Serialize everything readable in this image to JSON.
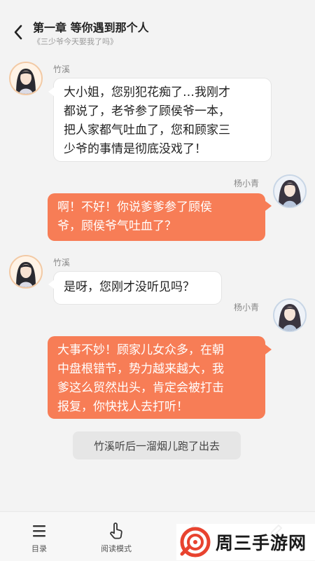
{
  "header": {
    "title": "第一章 等你遇到那个人",
    "subtitle": "《三少爷今天娶我了吗》"
  },
  "messages": [
    {
      "speaker": "竹溪",
      "side": "left",
      "text": [
        "大小姐，您别犯花痴了…我刚才",
        "都说了，老爷参了顾侯爷一本，",
        "把人家都气吐血了，您和顾家三",
        "少爷的事情是彻底没戏了！"
      ]
    },
    {
      "speaker": "杨小青",
      "side": "right",
      "text": [
        "啊！不好！你说爹爹参了顾侯",
        "爷，顾侯爷气吐血了？"
      ]
    },
    {
      "speaker": "竹溪",
      "side": "left",
      "text": [
        "是呀，您刚才没听见吗？"
      ]
    },
    {
      "speaker": "杨小青",
      "side": "right",
      "text": [
        "大事不妙！顾家儿女众多，在朝",
        "中盘根错节，势力越来越大，我",
        "爹这么贸然出头，肯定会被打击",
        "报复，你快找人去打听！"
      ]
    }
  ],
  "narration": "竹溪听后一溜烟儿跑了出去",
  "bottom_nav": [
    {
      "label": "目录",
      "icon": "menu-icon"
    },
    {
      "label": "阅读模式",
      "icon": "tap-hand-icon"
    },
    {
      "label": "",
      "icon": "undo-icon"
    },
    {
      "label": "",
      "icon": "edit-icon"
    }
  ],
  "watermark": {
    "text": "周三手游网"
  },
  "colors": {
    "accent": "#f77d56",
    "background": "#f3f3f3",
    "bubble_in": "#ffffff"
  }
}
